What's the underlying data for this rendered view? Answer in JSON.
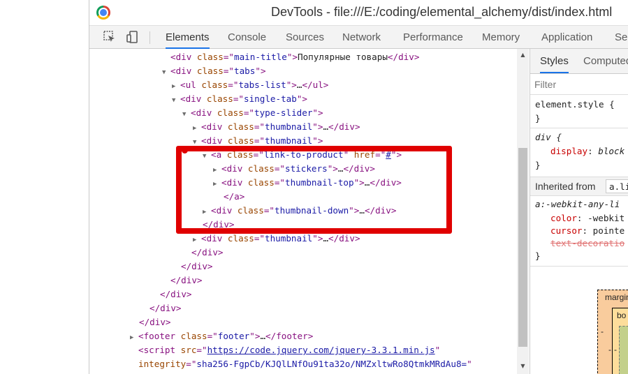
{
  "window": {
    "title": "DevTools - file:///E:/coding/elemental_alchemy/dist/index.html"
  },
  "toolbar": {
    "inspect_icon": "inspect-element-icon",
    "device_icon": "device-toolbar-icon",
    "tabs": [
      "Elements",
      "Console",
      "Sources",
      "Network",
      "Performance",
      "Memory",
      "Application",
      "Security"
    ],
    "active_tab": "Elements"
  },
  "dom": {
    "l1": {
      "tag1": "<div ",
      "attr": "class",
      "eq": "=\"",
      "val": "main-title",
      "close": "\">",
      "text": "Популярные товары",
      "end": "</div>"
    },
    "l2": {
      "tag1": "<div ",
      "attr": "class",
      "val": "tabs"
    },
    "l3": {
      "tag1": "<ul ",
      "attr": "class",
      "val": "tabs-list",
      "dots": "…",
      "end": "</ul>"
    },
    "l4": {
      "tag1": "<div ",
      "attr": "class",
      "val": "single-tab"
    },
    "l5": {
      "tag1": "<div ",
      "attr": "class",
      "val": "type-slider"
    },
    "l6": {
      "tag1": "<div ",
      "attr": "class",
      "val": "thumbnail",
      "dots": "…",
      "end": "</div>"
    },
    "l7": {
      "tag1": "<div ",
      "attr": "class",
      "val": "thumbnail"
    },
    "l8": {
      "tag1": "<a ",
      "attr": "class",
      "val": "link-to-product",
      "attr2": "href",
      "val2": "#"
    },
    "l9": {
      "tag1": "<div ",
      "attr": "class",
      "val": "stickers",
      "dots": "…",
      "end": "</div>"
    },
    "l10": {
      "tag1": "<div ",
      "attr": "class",
      "val": "thumbnail-top",
      "dots": "…",
      "end": "</div>"
    },
    "l11": {
      "end": "</a>"
    },
    "l12": {
      "tag1": "<div ",
      "attr": "class",
      "val": "thumbnail-down",
      "dots": "…",
      "end": "</div>"
    },
    "l13": {
      "end": "</div>"
    },
    "l14": {
      "tag1": "<div ",
      "attr": "class",
      "val": "thumbnail",
      "dots": "…",
      "end": "</div>"
    },
    "l15": {
      "end": "</div>"
    },
    "l16": {
      "end": "</div>"
    },
    "l17": {
      "end": "</div>"
    },
    "l18": {
      "end": "</div>"
    },
    "l19": {
      "end": "</div>"
    },
    "l20": {
      "end": "</div>"
    },
    "l21": {
      "tag1": "<footer ",
      "attr": "class",
      "val": "footer",
      "dots": "…",
      "end": "</footer>"
    },
    "l22": {
      "tag1": "<script ",
      "attr": "src",
      "val": "https://code.jquery.com/jquery-3.3.1.min.js"
    },
    "l23": {
      "attr": "integrity",
      "val": "sha256-FgpCb/KJQlLNfOu91ta32o/NMZxltwRo8QtmkMRdAu8="
    }
  },
  "styles_pane": {
    "tabs": [
      "Styles",
      "Computed"
    ],
    "active_tab": "Styles",
    "filter_placeholder": "Filter",
    "element_style": "element.style {",
    "close_brace": "}",
    "rule1_selector": "div {",
    "rule1_prop": "display",
    "rule1_val": "block",
    "inherited_from_label": "Inherited from",
    "inherited_from_chip": "a.li",
    "rule2_selector": "a:-webkit-any-li",
    "rule2_prop1": "color",
    "rule2_val1": "-webkit",
    "rule2_prop2": "cursor",
    "rule2_val2": "pointe",
    "rule2_prop3": "text-decoratio",
    "box_model_margin": "margin",
    "box_model_border": "bo",
    "box_model_dash": "-"
  },
  "colors": {
    "highlight": "#e00000",
    "tab_active": "#1a73e8",
    "tag": "#881280",
    "attr_name": "#994500",
    "attr_value": "#1a1aa6"
  }
}
